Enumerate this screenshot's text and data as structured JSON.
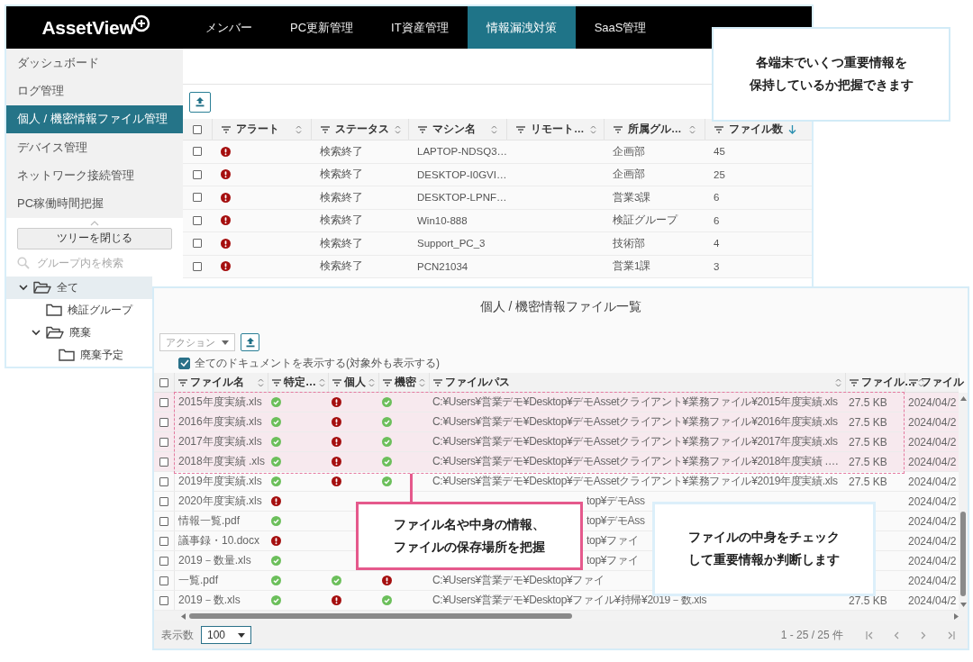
{
  "header": {
    "logo": "AssetView",
    "tabs": [
      {
        "label": "メンバー",
        "selected": false
      },
      {
        "label": "PC更新管理",
        "selected": false
      },
      {
        "label": "IT資産管理",
        "selected": false
      },
      {
        "label": "情報漏洩対策",
        "selected": true
      },
      {
        "label": "SaaS管理",
        "selected": false
      }
    ]
  },
  "sidebar": {
    "items": [
      {
        "label": "ダッシュボード",
        "selected": false
      },
      {
        "label": "ログ管理",
        "selected": false
      },
      {
        "label": "個人 / 機密情報ファイル管理",
        "selected": true
      },
      {
        "label": "デバイス管理",
        "selected": false
      },
      {
        "label": "ネットワーク接続管理",
        "selected": false
      },
      {
        "label": "PC稼働時間把握",
        "selected": false
      }
    ],
    "collapse_button": "ツリーを閉じる",
    "search": {
      "placeholder": "グループ内を検索"
    },
    "tree": [
      {
        "label": "全て",
        "selected": true,
        "expanded": true,
        "children": [
          {
            "label": "検証グループ",
            "selected": false
          },
          {
            "label": "廃棄",
            "selected": false,
            "expanded": true,
            "children": [
              {
                "label": "廃棄予定",
                "selected": false
              }
            ]
          }
        ]
      }
    ]
  },
  "machine_table": {
    "all_checked": false,
    "columns": [
      {
        "label": "アラート",
        "sorted_descending": false
      },
      {
        "label": "ステータス",
        "sorted_descending": false
      },
      {
        "label": "マシン名",
        "sorted_descending": false
      },
      {
        "label": "リモート…",
        "sorted_descending": false
      },
      {
        "label": "所属グル…",
        "sorted_descending": false
      },
      {
        "label": "ファイル数",
        "sorted_descending": true
      }
    ],
    "rows": [
      {
        "checked": false,
        "alert": true,
        "status": "検索終了",
        "machine": "LAPTOP-NDSQ3…",
        "group": "企画部",
        "file_count": "45"
      },
      {
        "checked": false,
        "alert": true,
        "status": "検索終了",
        "machine": "DESKTOP-I0GVI…",
        "group": "企画部",
        "file_count": "25"
      },
      {
        "checked": false,
        "alert": true,
        "status": "検索終了",
        "machine": "DESKTOP-LPNF…",
        "group": "営業3課",
        "file_count": "6"
      },
      {
        "checked": false,
        "alert": true,
        "status": "検索終了",
        "machine": "Win10-888",
        "group": "検証グループ",
        "file_count": "6"
      },
      {
        "checked": false,
        "alert": true,
        "status": "検索終了",
        "machine": "Support_PC_3",
        "group": "技術部",
        "file_count": "4"
      },
      {
        "checked": false,
        "alert": true,
        "status": "検索終了",
        "machine": "PCN21034",
        "group": "営業1課",
        "file_count": "3"
      }
    ]
  },
  "top_callout": {
    "lines": [
      "各端末でいくつ重要情報を",
      "保持しているか把握できます"
    ]
  },
  "file_panel": {
    "title": "個人 / 機密情報ファイル一覧",
    "action_dropdown": {
      "placeholder": "アクション"
    },
    "show_all": {
      "label": "全てのドキュメントを表示する(対象外も表示する)",
      "checked": true
    },
    "all_checked": false,
    "columns": [
      {
        "label": "ファイル名",
        "sorted_descending": false
      },
      {
        "label": "特定…",
        "sorted_descending": false
      },
      {
        "label": "個人",
        "sorted_descending": false
      },
      {
        "label": "機密",
        "sorted_descending": false
      },
      {
        "label": "ファイルパス",
        "sorted_descending": false
      },
      {
        "label": "ファイル…",
        "sorted_descending": false
      },
      {
        "label": "ファイル"
      }
    ],
    "rows": [
      {
        "kind": "full",
        "checked": false,
        "highlighted": true,
        "name": "2015年度実績.xls",
        "specific_flagged": false,
        "personal_flagged": true,
        "confidential_flagged": false,
        "path": "C:¥Users¥営業デモ¥Desktop¥デモAssetクライアント¥業務ファイル¥2015年度実績.xls",
        "size": "27.5 KB",
        "date": "2024/04/2"
      },
      {
        "kind": "full",
        "checked": false,
        "highlighted": true,
        "name": "2016年度実績.xls",
        "specific_flagged": false,
        "personal_flagged": true,
        "confidential_flagged": false,
        "path": "C:¥Users¥営業デモ¥Desktop¥デモAssetクライアント¥業務ファイル¥2016年度実績.xls",
        "size": "27.5 KB",
        "date": "2024/04/2"
      },
      {
        "kind": "full",
        "checked": false,
        "highlighted": true,
        "name": "2017年度実績.xls",
        "specific_flagged": false,
        "personal_flagged": true,
        "confidential_flagged": false,
        "path": "C:¥Users¥営業デモ¥Desktop¥デモAssetクライアント¥業務ファイル¥2017年度実績.xls",
        "size": "27.5 KB",
        "date": "2024/04/2"
      },
      {
        "kind": "full",
        "checked": false,
        "highlighted": true,
        "name": "2018年度実績 .xls",
        "specific_flagged": false,
        "personal_flagged": true,
        "confidential_flagged": false,
        "path": "C:¥Users¥営業デモ¥Desktop¥デモAssetクライアント¥業務ファイル¥2018年度実績 .…",
        "size": "27.5 KB",
        "date": "2024/04/2"
      },
      {
        "kind": "full",
        "checked": false,
        "highlighted": false,
        "name": "2019年度実績.xls",
        "specific_flagged": false,
        "personal_flagged": true,
        "confidential_flagged": false,
        "path": "C:¥Users¥営業デモ¥Desktop¥デモAssetクライアント¥業務ファイル¥2019年度実績.xls",
        "size": "27.5 KB",
        "date": "2024/04/2"
      },
      {
        "kind": "middle",
        "checked": false,
        "highlighted": false,
        "name": "2020年度実績.xls",
        "specific_flagged": true,
        "path": "top¥デモAss",
        "date": "2024/04/2"
      },
      {
        "kind": "middle",
        "checked": false,
        "highlighted": false,
        "name": "情報一覧.pdf",
        "specific_flagged": false,
        "path": "top¥デモAss",
        "date": "2024/04/2"
      },
      {
        "kind": "middle",
        "checked": false,
        "highlighted": false,
        "name": "議事録・10.docx",
        "specific_flagged": true,
        "path": "top¥ファイ",
        "date": "2024/04/2"
      },
      {
        "kind": "middle",
        "checked": false,
        "highlighted": false,
        "name": "2019－数量.xls",
        "specific_flagged": false,
        "path": "top¥ファイ",
        "date": "2024/04/2"
      },
      {
        "kind": "start",
        "checked": false,
        "highlighted": false,
        "name": "一覧.pdf",
        "specific_flagged": false,
        "personal_flagged": false,
        "confidential_flagged": true,
        "path": "C:¥Users¥営業デモ¥Desktop¥ファイ",
        "date": "2024/04/2"
      },
      {
        "kind": "full",
        "checked": false,
        "highlighted": false,
        "name": "2019－数.xls",
        "specific_flagged": false,
        "personal_flagged": true,
        "confidential_flagged": false,
        "path": "C:¥Users¥営業デモ¥Desktop¥ファイル¥持帰¥2019－数.xls",
        "size": "27.5 KB",
        "date": "2024/04/2"
      }
    ],
    "page_size": {
      "label": "表示数",
      "value": "100"
    },
    "range": "1 - 25 / 25 件"
  },
  "highlight_callout": {
    "lines": [
      "ファイル名や中身の情報、",
      "ファイルの保存場所を把握"
    ]
  },
  "content_callout": {
    "lines": [
      "ファイルの中身をチェック",
      "して重要情報か判断します"
    ]
  }
}
